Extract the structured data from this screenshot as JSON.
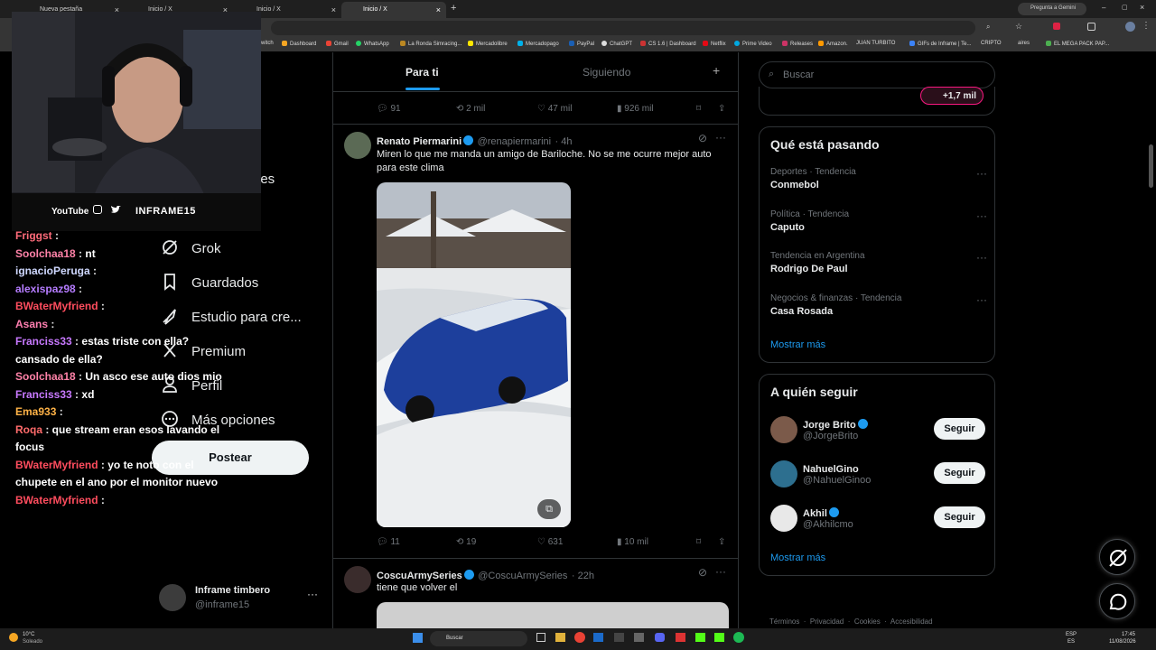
{
  "browser": {
    "tabs": [
      {
        "label": "Nueva pestaña"
      },
      {
        "label": "Inicio / X"
      },
      {
        "label": "Inicio / X"
      },
      {
        "label": "Inicio / X"
      }
    ],
    "gemini_button": "Pregunta a Gemini",
    "bookmarks": [
      "witch",
      "Dashboard",
      "Gmail",
      "WhatsApp",
      "La Ronda Simracing...",
      "Mercadolibre",
      "Mercadopago",
      "PayPal",
      "ChatGPT",
      "CS 1.6 | Dashboard",
      "Netflix",
      "Prime Video",
      "Releases",
      "Amazon.",
      "JUAN TURBITO",
      "GIFs de Inframe | Te...",
      "CRIPTO",
      "aires",
      "EL MEGA PACK PAP..."
    ]
  },
  "stream": {
    "socials": {
      "youtube": "YouTube",
      "channel": "INFRAME15"
    },
    "chat": [
      {
        "user": "Friggst",
        "color": "#ff6b7a",
        "text": ""
      },
      {
        "user": "Soolchaa18",
        "color": "#ff82a8",
        "text": "nt"
      },
      {
        "user": "ignacioPeruga",
        "color": "#cfd8ff",
        "text": ""
      },
      {
        "user": "alexispaz98",
        "color": "#b57cff",
        "text": ""
      },
      {
        "user": "BWaterMyfriend",
        "color": "#ff4d5e",
        "text": ""
      },
      {
        "user": "Asans",
        "color": "#ff7fb0",
        "text": ""
      },
      {
        "user": "Franciss33",
        "color": "#c879ff",
        "text": "estas triste con ella? cansado de ella?"
      },
      {
        "user": "Soolchaa18",
        "color": "#ff82a8",
        "text": "Un asco ese auto dios mio"
      },
      {
        "user": "Franciss33",
        "color": "#c879ff",
        "text": "xd"
      },
      {
        "user": "Ema933",
        "color": "#ffb347",
        "text": ""
      },
      {
        "user": "Roqa",
        "color": "#ff6b6b",
        "text": "que stream eran esos lavando el focus"
      },
      {
        "user": "BWaterMyfriend",
        "color": "#ff4d5e",
        "text": "yo te noto con el chupete en el ano por el monitor nuevo"
      },
      {
        "user": "BWaterMyfriend",
        "color": "#ff4d5e",
        "text": ""
      }
    ]
  },
  "nav": {
    "partial_label": "nes",
    "items": [
      {
        "label": "Grok",
        "icon": "grok-icon"
      },
      {
        "label": "Guardados",
        "icon": "bookmark-icon"
      },
      {
        "label": "Estudio para cre...",
        "icon": "rocket-icon"
      },
      {
        "label": "Premium",
        "icon": "x-icon"
      },
      {
        "label": "Perfil",
        "icon": "person-icon"
      },
      {
        "label": "Más opciones",
        "icon": "more-circle-icon"
      }
    ],
    "post_button": "Postear",
    "account": {
      "name": "Inframe timbero",
      "handle": "@inframe15"
    }
  },
  "timeline": {
    "tabs": [
      "Para ti",
      "Siguiendo"
    ],
    "top_actions": {
      "replies": "91",
      "reposts": "2 mil",
      "likes": "47 mil",
      "views": "926 mil"
    },
    "posts": [
      {
        "name": "Renato Piermarini",
        "handle": "@renapiermarini",
        "time": "· 4h",
        "text": "Miren lo que me manda un amigo de Bariloche. No se me ocurre mejor auto para este clima",
        "actions": {
          "replies": "11",
          "reposts": "19",
          "likes": "631",
          "views": "10 mil"
        }
      },
      {
        "name": "CoscuArmySeries",
        "handle": "@CoscuArmySeries",
        "time": "· 22h",
        "text": "tiene que volver el"
      }
    ]
  },
  "sidebar_right": {
    "search_placeholder": "Buscar",
    "pill": "+1,7 mil",
    "trends_title": "Qué está pasando",
    "trends": [
      {
        "category": "Deportes · Tendencia",
        "name": "Conmebol"
      },
      {
        "category": "Política · Tendencia",
        "name": "Caputo"
      },
      {
        "category": "Tendencia en Argentina",
        "name": "Rodrigo De Paul"
      },
      {
        "category": "Negocios & finanzas · Tendencia",
        "name": "Casa Rosada"
      }
    ],
    "show_more": "Mostrar más",
    "who_to_follow_title": "A quién seguir",
    "follow": [
      {
        "name": "Jorge Brito",
        "handle": "@JorgeBrito",
        "button": "Seguir"
      },
      {
        "name": "NahuelGino",
        "handle": "@NahuelGinoo",
        "button": "Seguir"
      },
      {
        "name": "Akhil",
        "handle": "@Akhilcmo",
        "button": "Seguir"
      }
    ],
    "show_more_2": "Mostrar más",
    "footer": [
      "Términos",
      "Privacidad",
      "Cookies",
      "Accesibilidad"
    ]
  },
  "taskbar": {
    "weather_temp": "10°C",
    "weather_text": "Soleado",
    "search": "Buscar",
    "lang1": "ESP",
    "lang2": "ES",
    "time": "17:45",
    "date": "11/08/2026"
  }
}
